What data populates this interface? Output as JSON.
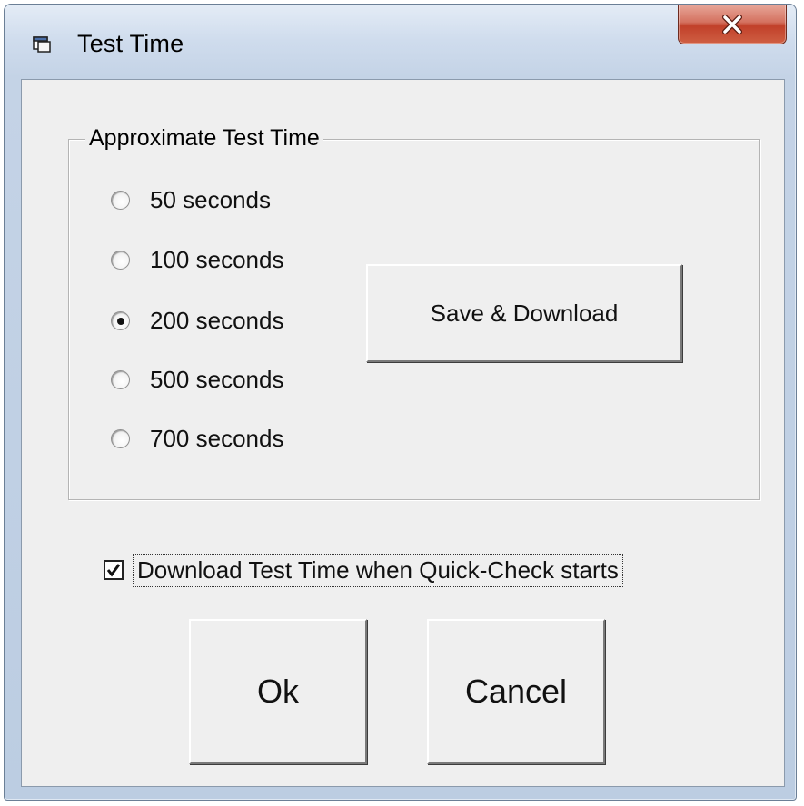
{
  "window": {
    "title": "Test Time"
  },
  "group": {
    "legend": "Approximate Test Time",
    "options": [
      {
        "label": "50 seconds",
        "selected": false
      },
      {
        "label": "100 seconds",
        "selected": false
      },
      {
        "label": "200 seconds",
        "selected": true
      },
      {
        "label": "500 seconds",
        "selected": false
      },
      {
        "label": "700 seconds",
        "selected": false
      }
    ],
    "save_button_label": "Save & Download"
  },
  "checkbox": {
    "label": "Download Test Time when Quick-Check starts",
    "checked": true
  },
  "buttons": {
    "ok_label": "Ok",
    "cancel_label": "Cancel"
  },
  "icons": {
    "window": "window-icon",
    "close": "close-icon",
    "check": "checkmark-icon"
  },
  "colors": {
    "close_button": "#c1402a",
    "dialog_face": "#efefef",
    "title_gradient_top": "#e4ecf6"
  }
}
